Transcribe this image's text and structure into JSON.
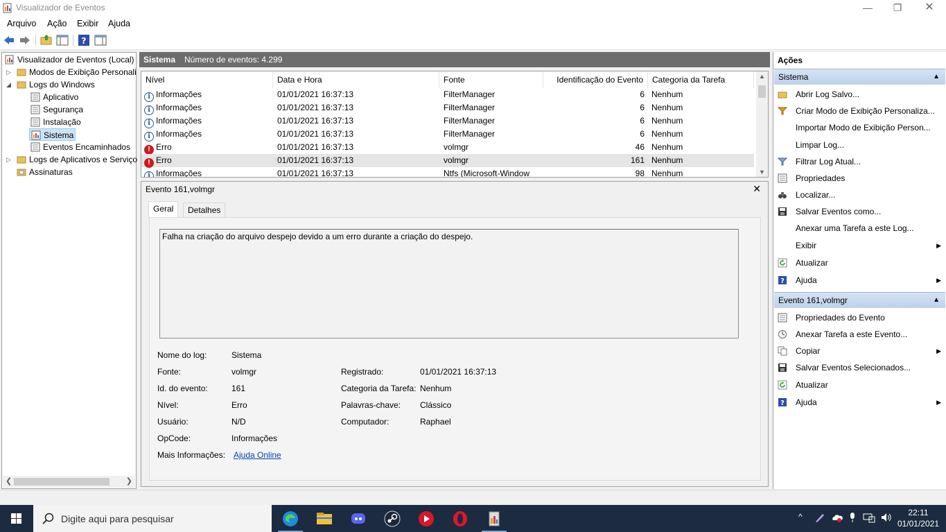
{
  "window": {
    "title": "Visualizador de Eventos"
  },
  "menu": [
    "Arquivo",
    "Ação",
    "Exibir",
    "Ajuda"
  ],
  "tree": {
    "root": "Visualizador de Eventos (Local)",
    "custom_views": "Modos de Exibição Personali",
    "windows_logs": "Logs do Windows",
    "app": "Aplicativo",
    "security": "Segurança",
    "setup": "Instalação",
    "system": "Sistema",
    "forwarded": "Eventos Encaminhados",
    "apps_services": "Logs de Aplicativos e Serviço",
    "subscriptions": "Assinaturas"
  },
  "list": {
    "header_title": "Sistema",
    "header_count": "Número de eventos: 4.299",
    "columns": [
      "Nível",
      "Data e Hora",
      "Fonte",
      "Identificação do Evento",
      "Categoria da Tarefa"
    ],
    "rows": [
      {
        "level": "Informações",
        "date": "01/01/2021 16:37:13",
        "source": "FilterManager",
        "id": "6",
        "category": "Nenhum"
      },
      {
        "level": "Informações",
        "date": "01/01/2021 16:37:13",
        "source": "FilterManager",
        "id": "6",
        "category": "Nenhum"
      },
      {
        "level": "Informações",
        "date": "01/01/2021 16:37:13",
        "source": "FilterManager",
        "id": "6",
        "category": "Nenhum"
      },
      {
        "level": "Informações",
        "date": "01/01/2021 16:37:13",
        "source": "FilterManager",
        "id": "6",
        "category": "Nenhum"
      },
      {
        "level": "Erro",
        "date": "01/01/2021 16:37:13",
        "source": "volmgr",
        "id": "46",
        "category": "Nenhum"
      },
      {
        "level": "Erro",
        "date": "01/01/2021 16:37:13",
        "source": "volmgr",
        "id": "161",
        "category": "Nenhum"
      },
      {
        "level": "Informações",
        "date": "01/01/2021 16:37:13",
        "source": "Ntfs (Microsoft-Window",
        "id": "98",
        "category": "Nenhum"
      }
    ]
  },
  "detail": {
    "title": "Evento 161,volmgr",
    "tabs": [
      "Geral",
      "Detalhes"
    ],
    "description": "Falha na criação do arquivo despejo devido a um erro durante a criação do despejo.",
    "labels": {
      "log_name": "Nome do log:",
      "source": "Fonte:",
      "event_id": "Id. do evento:",
      "level": "Nível:",
      "user": "Usuário:",
      "opcode": "OpCode:",
      "more_info": "Mais Informações:",
      "logged": "Registrado:",
      "task_category": "Categoria da Tarefa:",
      "keywords": "Palavras-chave:",
      "computer": "Computador:"
    },
    "values": {
      "log_name": "Sistema",
      "source": "volmgr",
      "event_id": "161",
      "level": "Erro",
      "user": "N/D",
      "opcode": "Informações",
      "more_info": "Ajuda Online",
      "logged": "01/01/2021 16:37:13",
      "task_category": "Nenhum",
      "keywords": "Clássico",
      "computer": "Raphael"
    }
  },
  "actions": {
    "title": "Ações",
    "group1": "Sistema",
    "group1_items": [
      "Abrir Log Salvo...",
      "Criar Modo de Exibição Personaliza...",
      "Importar Modo de Exibição Person...",
      "Limpar Log...",
      "Filtrar Log Atual...",
      "Propriedades",
      "Localizar...",
      "Salvar Eventos como...",
      "Anexar uma Tarefa a este Log...",
      "Exibir",
      "Atualizar",
      "Ajuda"
    ],
    "group2": "Evento 161,volmgr",
    "group2_items": [
      "Propriedades do Evento",
      "Anexar Tarefa a este Evento...",
      "Copiar",
      "Salvar Eventos Selecionados...",
      "Atualizar",
      "Ajuda"
    ]
  },
  "taskbar": {
    "search_placeholder": "Digite aqui para pesquisar",
    "time": "22:11",
    "date": "01/01/2021"
  }
}
